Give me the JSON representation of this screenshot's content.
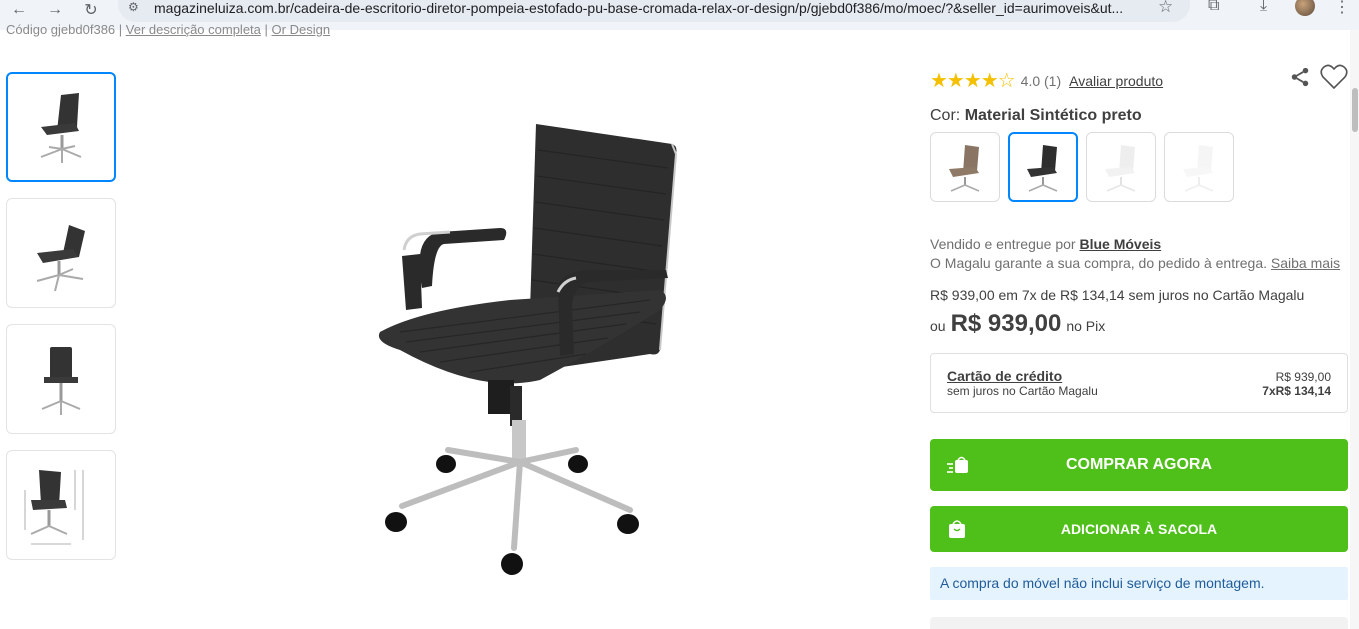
{
  "browser": {
    "url": "magazineluiza.com.br/cadeira-de-escritorio-diretor-pompeia-estofado-pu-base-cromada-relax-or-design/p/gjebd0f386/mo/moec/?&seller_id=aurimoveis&ut..."
  },
  "breadcrumb": {
    "code": "Código gjebd0f386 |",
    "full_description": "Ver descrição completa",
    "separator": "|",
    "brand": "Or Design"
  },
  "rating": {
    "stars": "★★★★☆",
    "value": "4.0 (1)",
    "rate_link": "Avaliar produto"
  },
  "color": {
    "label": "Cor:",
    "selected": "Material Sintético preto"
  },
  "seller": {
    "prefix": "Vendido e entregue por",
    "name": "Blue Móveis",
    "guarantee": "O Magalu garante a sua compra, do pedido à entrega.",
    "learn_more": "Saiba mais"
  },
  "pricing": {
    "installments_text": "R$ 939,00 em 7x de R$ 134,14 sem juros no Cartão Magalu",
    "pix_prefix": "ou",
    "pix_price": "R$ 939,00",
    "pix_label": "no Pix"
  },
  "card": {
    "title": "Cartão de crédito",
    "subtitle": "sem juros no Cartão Magalu",
    "total": "R$ 939,00",
    "installment": "7xR$ 134,14"
  },
  "buttons": {
    "buy_now": "COMPRAR AGORA",
    "add_to_bag": "ADICIONAR À SACOLA"
  },
  "info": {
    "assembly_notice": "A compra do móvel não inclui serviço de montagem."
  },
  "colors": {
    "accent_blue": "#0086ff",
    "buy_green": "#4fbf1a",
    "star_yellow": "#f4c000",
    "info_bg": "#e5f3ff"
  }
}
